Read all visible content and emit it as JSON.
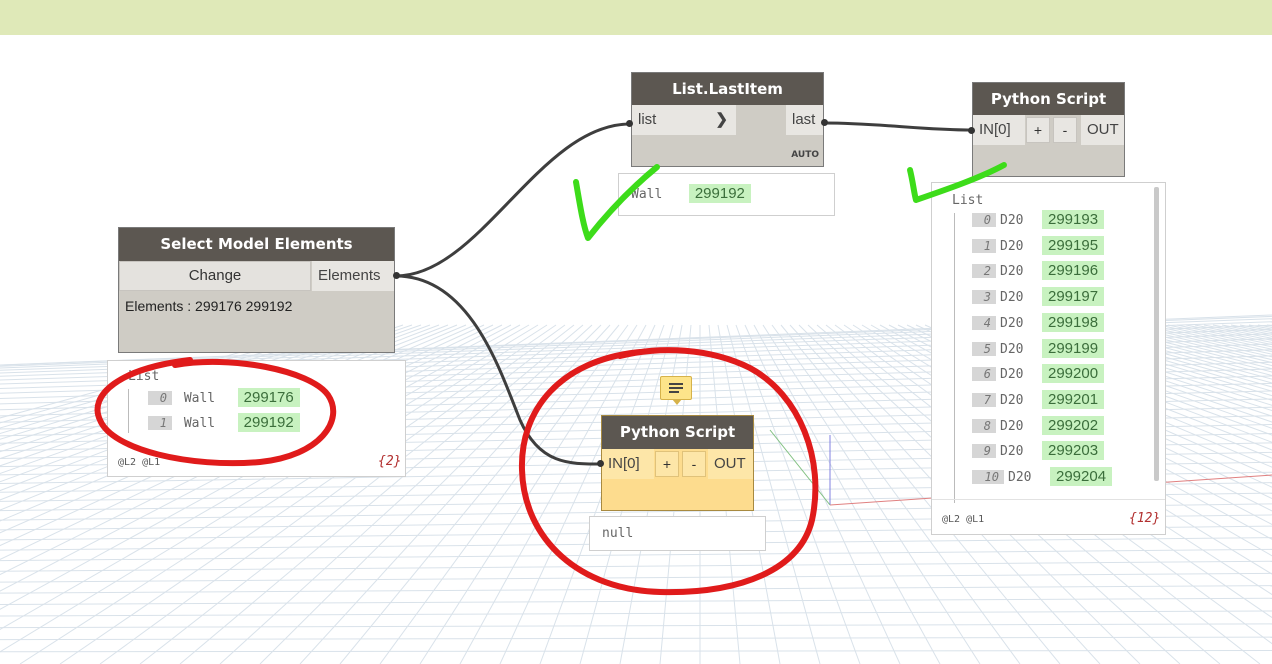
{
  "nodes": {
    "select_model_elements": {
      "title": "Select Model Elements",
      "change_button": "Change",
      "output_port": "Elements",
      "summary": "Elements : 299176 299192",
      "preview": {
        "header": "List",
        "items": [
          {
            "index": "0",
            "type": "Wall",
            "id": "299176"
          },
          {
            "index": "1",
            "type": "Wall",
            "id": "299192"
          }
        ],
        "levels": "@L2 @L1",
        "count": "{2}"
      }
    },
    "list_last_item": {
      "title": "List.LastItem",
      "input_port": "list",
      "output_port": "last",
      "lacing": "AUTO",
      "preview": {
        "type": "Wall",
        "id": "299192"
      }
    },
    "python_script_top": {
      "title": "Python Script",
      "input_port": "IN[0]",
      "add_label": "+",
      "remove_label": "-",
      "output_port": "OUT",
      "preview": {
        "header": "List",
        "items": [
          {
            "index": "0",
            "type": "D20",
            "id": "299193"
          },
          {
            "index": "1",
            "type": "D20",
            "id": "299195"
          },
          {
            "index": "2",
            "type": "D20",
            "id": "299196"
          },
          {
            "index": "3",
            "type": "D20",
            "id": "299197"
          },
          {
            "index": "4",
            "type": "D20",
            "id": "299198"
          },
          {
            "index": "5",
            "type": "D20",
            "id": "299199"
          },
          {
            "index": "6",
            "type": "D20",
            "id": "299200"
          },
          {
            "index": "7",
            "type": "D20",
            "id": "299201"
          },
          {
            "index": "8",
            "type": "D20",
            "id": "299202"
          },
          {
            "index": "9",
            "type": "D20",
            "id": "299203"
          },
          {
            "index": "10",
            "type": "D20",
            "id": "299204"
          }
        ],
        "levels": "@L2 @L1",
        "count": "{12}"
      }
    },
    "python_script_bottom": {
      "title": "Python Script",
      "input_port": "IN[0]",
      "add_label": "+",
      "remove_label": "-",
      "output_port": "OUT",
      "preview": {
        "value": "null"
      }
    }
  },
  "colors": {
    "node_header": "#5c5751",
    "node_body": "#cfccc5",
    "warning_body": "#fddc8e",
    "value_chip": "#c8f2c0",
    "annotation_red": "#e01b1b",
    "annotation_green": "#3ddc1a",
    "top_bar": "#dfe9b8"
  }
}
